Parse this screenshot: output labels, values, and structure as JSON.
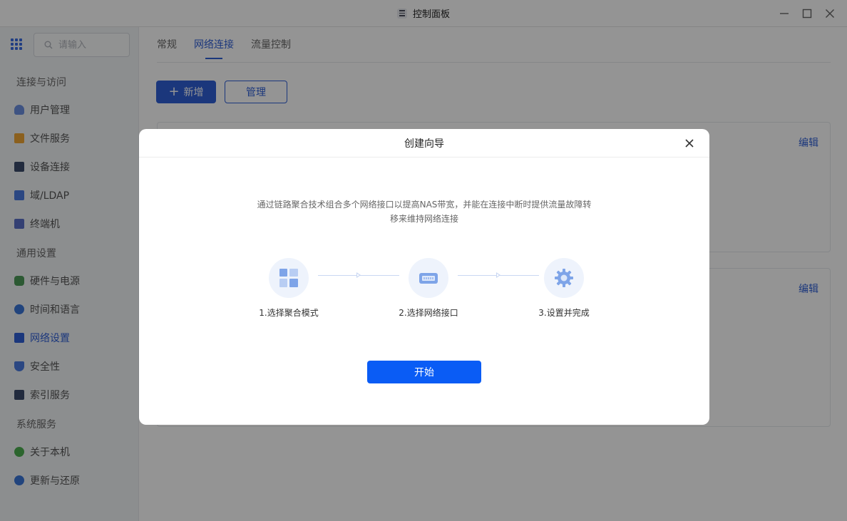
{
  "window": {
    "title": "控制面板",
    "icon": "control-panel-icon"
  },
  "sidebar": {
    "search_placeholder": "请输入",
    "groups": [
      {
        "label": "连接与访问"
      },
      {
        "label": "通用设置"
      },
      {
        "label": "系统服务"
      }
    ],
    "items": [
      {
        "label": "用户管理",
        "icon": "user-icon",
        "color": "#6b8fe0"
      },
      {
        "label": "文件服务",
        "icon": "folder-icon",
        "color": "#f0a534"
      },
      {
        "label": "设备连接",
        "icon": "device-icon",
        "color": "#3b4a6b"
      },
      {
        "label": "域/LDAP",
        "icon": "domain-icon",
        "color": "#4a7be0"
      },
      {
        "label": "终端机",
        "icon": "terminal-icon",
        "color": "#5b6fc7"
      },
      {
        "label": "硬件与电源",
        "icon": "power-icon",
        "color": "#4c9a58"
      },
      {
        "label": "时间和语言",
        "icon": "globe-icon",
        "color": "#3a75d8"
      },
      {
        "label": "网络设置",
        "icon": "network-icon",
        "color": "#2f5fd6"
      },
      {
        "label": "安全性",
        "icon": "shield-icon",
        "color": "#4a7be0"
      },
      {
        "label": "索引服务",
        "icon": "index-icon",
        "color": "#3b4a6b"
      },
      {
        "label": "关于本机",
        "icon": "info-icon",
        "color": "#4caf50"
      },
      {
        "label": "更新与还原",
        "icon": "refresh-icon",
        "color": "#3a75d8"
      }
    ],
    "active_item": "网络设置"
  },
  "main": {
    "tabs": [
      {
        "label": "常规"
      },
      {
        "label": "网络连接"
      },
      {
        "label": "流量控制"
      }
    ],
    "active_tab": "网络连接",
    "add_button": "新增",
    "manage_button": "管理",
    "cards": [
      {
        "edit_label": "编辑"
      },
      {
        "edit_label": "编辑"
      }
    ]
  },
  "dialog": {
    "title": "创建向导",
    "description_line1": "通过链路聚合技术组合多个网络接口以提高NAS带宽，并能在连接中断时提供流量故障转",
    "description_line2": "移来维持网络连接",
    "steps": [
      {
        "label": "1.选择聚合模式",
        "icon": "grid-layout-icon"
      },
      {
        "label": "2.选择网络接口",
        "icon": "network-port-icon"
      },
      {
        "label": "3.设置并完成",
        "icon": "gear-icon"
      }
    ],
    "start_button": "开始"
  },
  "colors": {
    "accent": "#2f5fd6",
    "primary_button": "#0a5cf5",
    "step_bg": "#eef3fc"
  }
}
